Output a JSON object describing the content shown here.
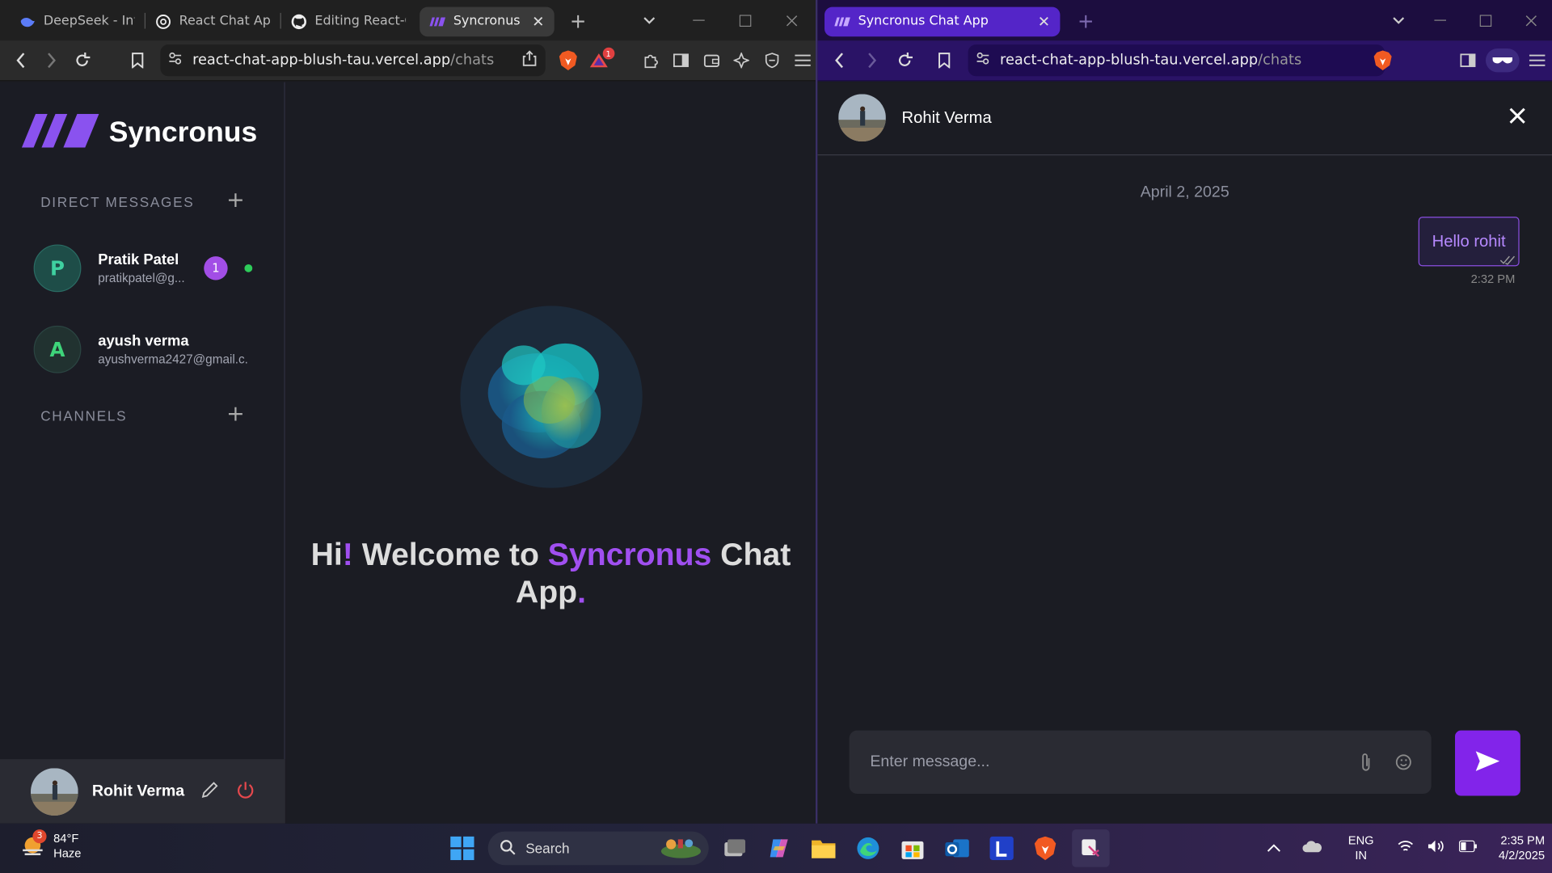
{
  "left_window": {
    "tabs": [
      {
        "label": "DeepSeek - Into t",
        "icon": "deepseek-icon"
      },
      {
        "label": "React Chat App |",
        "icon": "openai-icon"
      },
      {
        "label": "Editing React-Ch",
        "icon": "github-icon"
      },
      {
        "label": "Syncronus C",
        "icon": "syncronus-icon",
        "active": true
      }
    ],
    "url_host": "react-chat-app-blush-tau.vercel.app",
    "url_path": "/chats",
    "notification_count": "1"
  },
  "right_window": {
    "tabs": [
      {
        "label": "Syncronus Chat App",
        "icon": "syncronus-icon",
        "active": true
      }
    ],
    "url_host": "react-chat-app-blush-tau.vercel.app",
    "url_path": "/chats"
  },
  "app": {
    "brand": "Syncronus",
    "sections": {
      "direct_messages": "DIRECT MESSAGES",
      "channels": "CHANNELS"
    },
    "contacts": [
      {
        "initial": "P",
        "name": "Pratik Patel",
        "email": "pratikpatel@g...",
        "unread": "1",
        "online": true
      },
      {
        "initial": "A",
        "name": "ayush verma",
        "email": "ayushverma2427@gmail.c...",
        "online": false
      }
    ],
    "current_user": "Rohit Verma",
    "welcome": {
      "part1": "Hi",
      "bang": "!",
      "part2": " Welcome to ",
      "brand": "Syncronus",
      "part3": " Chat App",
      "dot": "."
    }
  },
  "chat": {
    "contact_name": "Rohit Verma",
    "date": "April 2, 2025",
    "messages": [
      {
        "text": "Hello rohit",
        "time": "2:32 PM",
        "sent": true
      }
    ],
    "input_placeholder": "Enter message..."
  },
  "taskbar": {
    "weather_temp": "84°F",
    "weather_desc": "Haze",
    "weather_badge": "3",
    "search_label": "Search",
    "lang_top": "ENG",
    "lang_bottom": "IN",
    "time": "2:35 PM",
    "date": "4/2/2025"
  },
  "colors": {
    "accent": "#8224ea",
    "brand_purple": "#a04ff0",
    "online": "#2ecc5a"
  }
}
